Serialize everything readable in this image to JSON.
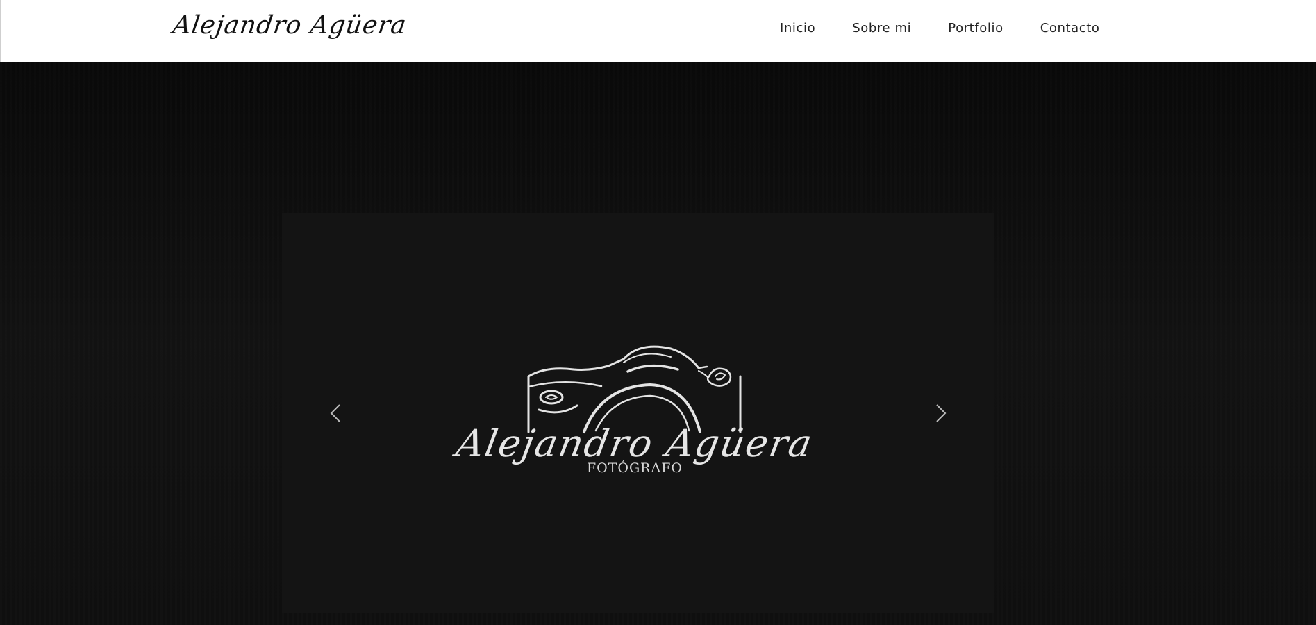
{
  "header": {
    "brand": "Alejandro Agüera",
    "nav": [
      {
        "label": "Inicio"
      },
      {
        "label": "Sobre mi"
      },
      {
        "label": "Portfolio"
      },
      {
        "label": "Contacto"
      }
    ]
  },
  "slider": {
    "slide_logo": {
      "script_text": "Alejandro Agüera",
      "subtitle": "FOTÓGRAFO",
      "icon": "camera-icon"
    },
    "prev_icon": "chevron-left-icon",
    "next_icon": "chevron-right-icon"
  },
  "colors": {
    "header_bg": "#ffffff",
    "hero_bg": "#0c0c0c",
    "slide_bg": "#141414",
    "logo_color": "#e6e6e6"
  }
}
